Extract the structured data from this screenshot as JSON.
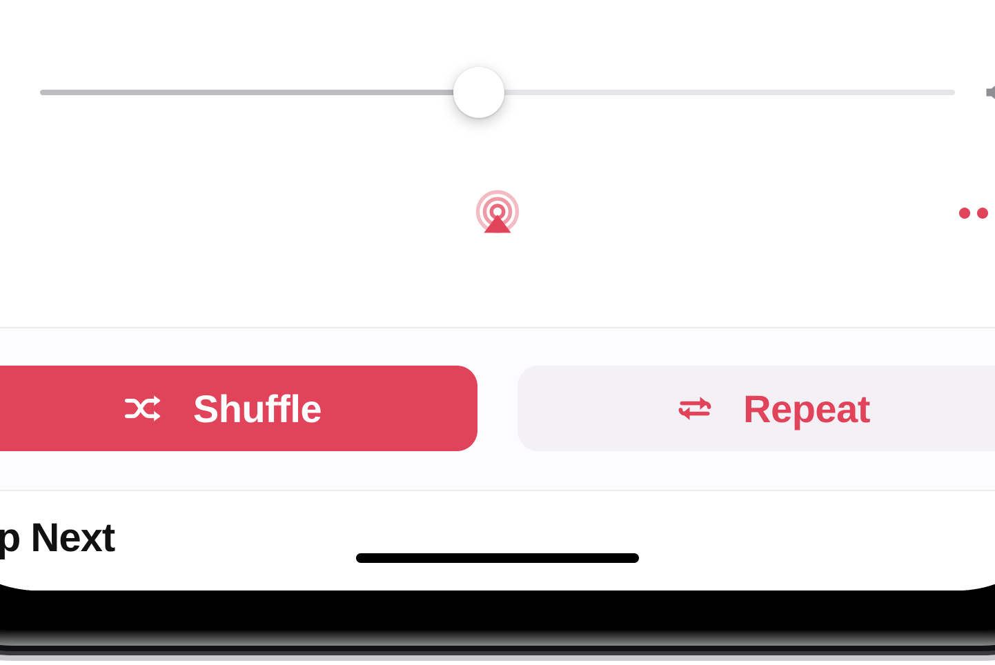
{
  "volume": {
    "percent": 48
  },
  "colors": {
    "accent": "#e0435a"
  },
  "controls": {
    "shuffle_label": "Shuffle",
    "repeat_label": "Repeat",
    "shuffle_on": true,
    "repeat_on": false
  },
  "up_next": {
    "title": "Up Next"
  },
  "icons": {
    "volume_min": "speaker-mute-icon",
    "volume_max": "speaker-loud-icon",
    "airplay": "airplay-icon",
    "more": "more-icon",
    "shuffle": "shuffle-icon",
    "repeat": "repeat-icon"
  }
}
